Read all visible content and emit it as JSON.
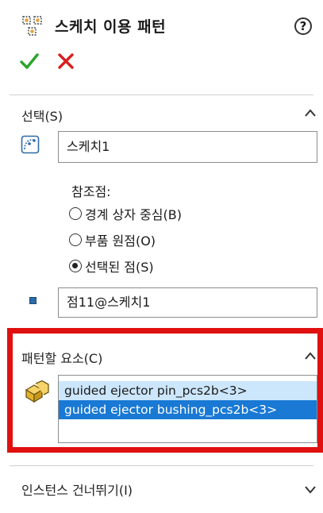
{
  "panel": {
    "title": "스케치 이용 패턴",
    "help_glyph": "?"
  },
  "actions": {
    "ok_glyph": "✓",
    "cancel_glyph": "✕"
  },
  "selection": {
    "title": "선택(S)",
    "sketch_value": "스케치1",
    "reference_label": "참조점:",
    "radio_options": [
      {
        "label": "경계 상자 중심(B)",
        "checked": false
      },
      {
        "label": "부품 원점(O)",
        "checked": false
      },
      {
        "label": "선택된 점(S)",
        "checked": true
      }
    ],
    "point_value": "점11@스케치1"
  },
  "features": {
    "title": "패턴할 요소(C)",
    "items": [
      {
        "label": "guided ejector pin_pcs2b<3>",
        "state": "highlighted"
      },
      {
        "label": "guided ejector bushing_pcs2b<3>",
        "state": "selected"
      }
    ]
  },
  "skip": {
    "title": "인스턴스 건너뛰기(I)"
  },
  "colors": {
    "ok": "#2aa52a",
    "cancel": "#d91e1e",
    "highlight_box": "#e01010",
    "selected_item": "#1979d4"
  }
}
